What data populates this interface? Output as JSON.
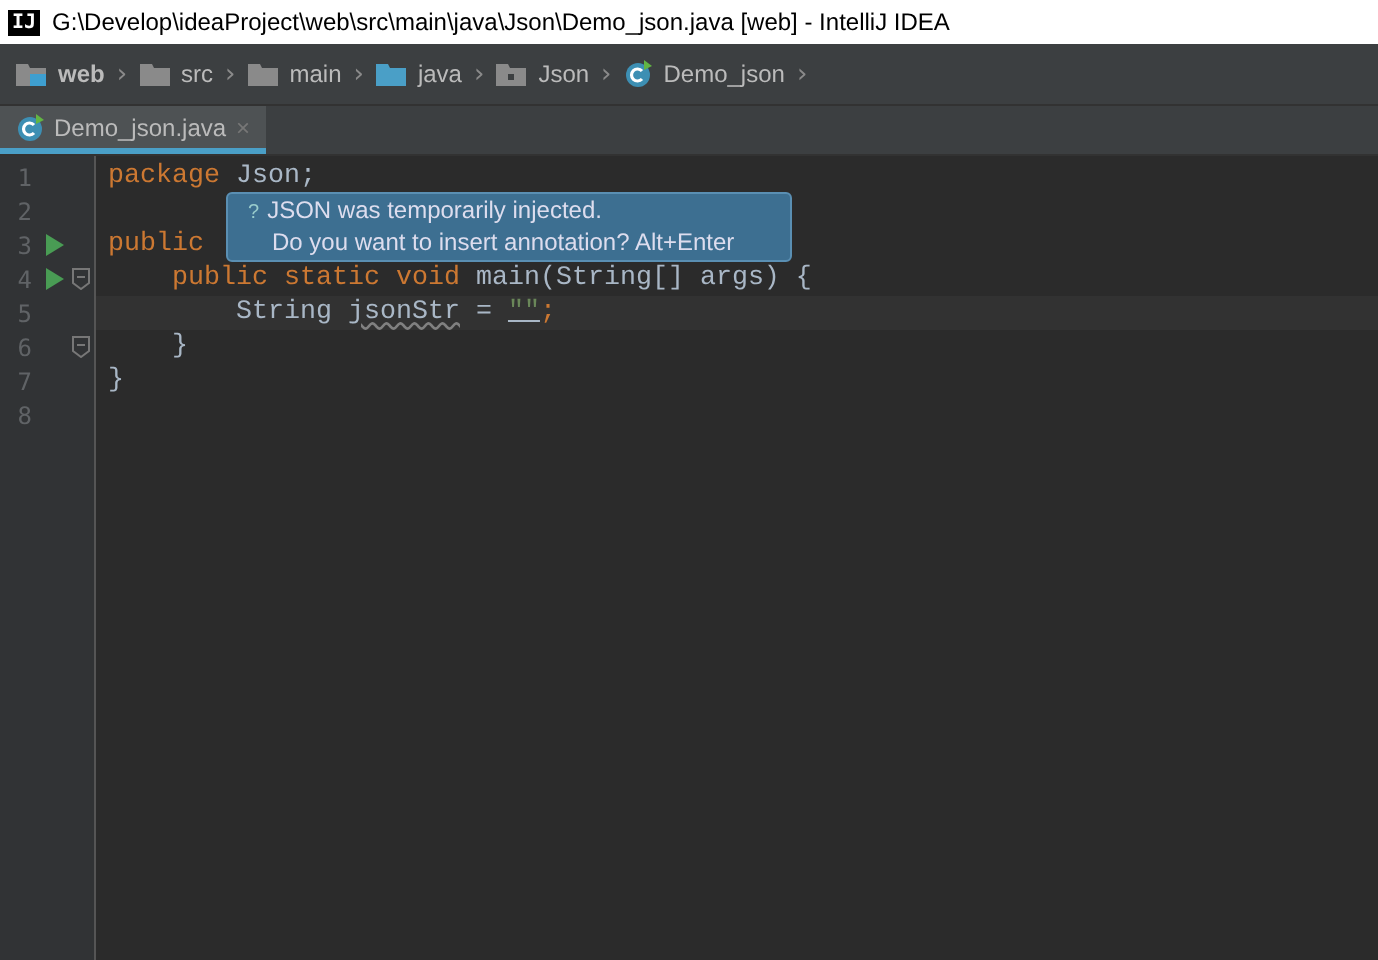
{
  "window": {
    "title": "G:\\Develop\\ideaProject\\web\\src\\main\\java\\Json\\Demo_json.java [web] - IntelliJ IDEA",
    "app_icon": "IJ"
  },
  "breadcrumbs": [
    {
      "label": "web",
      "kind": "module",
      "separator": "›"
    },
    {
      "label": "src",
      "kind": "folder",
      "separator": "›"
    },
    {
      "label": "main",
      "kind": "folder",
      "separator": "›"
    },
    {
      "label": "java",
      "kind": "source",
      "separator": "›"
    },
    {
      "label": "Json",
      "kind": "package",
      "separator": "›"
    },
    {
      "label": "Demo_json",
      "kind": "class",
      "separator": "›"
    }
  ],
  "tabs": [
    {
      "label": "Demo_json.java",
      "selected": true,
      "close": "×"
    }
  ],
  "editor": {
    "lines": [
      {
        "number": "1",
        "tokens": [
          {
            "text": "package ",
            "kind": "keyword"
          },
          {
            "text": "Json;",
            "kind": "plain"
          }
        ]
      },
      {
        "number": "2"
      },
      {
        "number": "3",
        "run": true,
        "tokens": [
          {
            "text": "public ",
            "kind": "keyword"
          }
        ]
      },
      {
        "number": "4",
        "run": true,
        "fold": true,
        "tokens": [
          {
            "text": "    public static void ",
            "kind": "keyword"
          },
          {
            "text": "main(String[] args) {",
            "kind": "plain"
          }
        ]
      },
      {
        "number": "5",
        "current": true,
        "tokens": [
          {
            "text": "        String ",
            "kind": "plain"
          },
          {
            "text": "jsonStr",
            "kind": "warn"
          },
          {
            "text": " = ",
            "kind": "plain"
          },
          {
            "text": "\"\"",
            "kind": "string"
          },
          {
            "text": ";",
            "kind": "keyword"
          }
        ]
      },
      {
        "number": "6",
        "fold": true,
        "tokens": [
          {
            "text": "    }",
            "kind": "plain"
          }
        ]
      },
      {
        "number": "7",
        "tokens": [
          {
            "text": "}",
            "kind": "plain"
          }
        ]
      },
      {
        "number": "8"
      }
    ]
  },
  "tooltip": {
    "icon": "?",
    "lines": [
      "JSON was temporarily injected.",
      "Do you want to insert annotation? Alt+Enter"
    ]
  }
}
